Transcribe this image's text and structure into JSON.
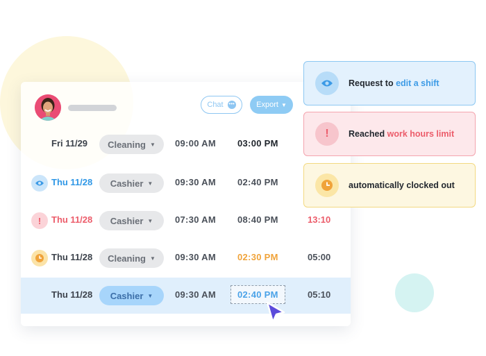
{
  "colors": {
    "accent_blue": "#2f97e6",
    "alert_red": "#ec5c6a",
    "warning_orange": "#f0a33a",
    "selected_row": "#e0effc"
  },
  "header": {
    "chat_label": "Chat",
    "chat_icon": "chat-bubble-icon",
    "export_label": "Export",
    "export_icon": "chevron-down-icon"
  },
  "rows": [
    {
      "status_icon": "",
      "date": "Fri 11/29",
      "role": "Cleaning",
      "start": "09:00 AM",
      "end": "03:00 PM",
      "total": ""
    },
    {
      "status_icon": "eye-icon",
      "date": "Thu 11/28",
      "role": "Cashier",
      "start": "09:30 AM",
      "end": "02:40 PM",
      "total": ""
    },
    {
      "status_icon": "alert-icon",
      "date": "Thu 11/28",
      "role": "Cashier",
      "start": "07:30 AM",
      "end": "08:40 PM",
      "total": "13:10"
    },
    {
      "status_icon": "clock-icon",
      "date": "Thu 11/28",
      "role": "Cleaning",
      "start": "09:30 AM",
      "end": "02:30 PM",
      "total": "05:00"
    },
    {
      "status_icon": "",
      "date": "Thu 11/28",
      "role": "Cashier",
      "start": "09:30 AM",
      "end": "02:40 PM",
      "total": "05:10"
    }
  ],
  "notifications": [
    {
      "icon": "eye-icon",
      "prefix": "Request to ",
      "highlight": "edit a shift"
    },
    {
      "icon": "alert-icon",
      "prefix": "Reached ",
      "highlight": "work hours limit"
    },
    {
      "icon": "clock-icon",
      "prefix": "automatically clocked out",
      "highlight": ""
    }
  ]
}
